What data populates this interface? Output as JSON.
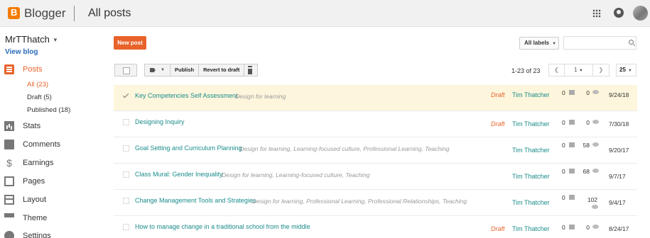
{
  "header": {
    "app_name": "Blogger",
    "page_title": "All posts"
  },
  "sidebar": {
    "blog_name": "MrTThatch",
    "view_blog": "View blog",
    "posts_label": "Posts",
    "sub_items": [
      "All (23)",
      "Draft (5)",
      "Published (18)"
    ],
    "nav": [
      "Stats",
      "Comments",
      "Earnings",
      "Pages",
      "Layout",
      "Theme",
      "Settings"
    ]
  },
  "main": {
    "new_post": "New post",
    "all_labels": "All labels",
    "search_placeholder": "",
    "toolbar": {
      "publish": "Publish",
      "revert": "Revert to draft"
    },
    "count": "1-23 of 23",
    "pager": {
      "page": "1",
      "per_page": "25"
    }
  },
  "posts": [
    {
      "title": "Key Competencies Self Assessment",
      "labels": "Design for learning",
      "status": "Draft",
      "author": "Tim Thatcher",
      "comments": "0",
      "views": "0",
      "date": "9/24/18"
    },
    {
      "title": "Designing Inquiry",
      "labels": "",
      "status": "Draft",
      "author": "Tim Thatcher",
      "comments": "0",
      "views": "0",
      "date": "7/30/18"
    },
    {
      "title": "Goal Setting and Curriculum Planning",
      "labels": "Design for learning, Learning-focused culture, Professional Learning, Teaching",
      "status": "",
      "author": "Tim Thatcher",
      "comments": "0",
      "views": "58",
      "date": "9/20/17"
    },
    {
      "title": "Class Mural: Gender Inequality",
      "labels": "Design for learning, Learning-focused culture, Teaching",
      "status": "",
      "author": "Tim Thatcher",
      "comments": "0",
      "views": "68",
      "date": "9/7/17"
    },
    {
      "title": "Change Management Tools and Strategies",
      "labels": "Design for learning, Professional Learning, Professional Relationships, Teaching",
      "status": "",
      "author": "Tim Thatcher",
      "comments": "0",
      "views": "102",
      "date": "9/4/17"
    },
    {
      "title": "How to manage change in a traditional school from the middle",
      "labels": "",
      "status": "Draft",
      "author": "Tim Thatcher",
      "comments": "0",
      "views": "0",
      "date": "8/24/17"
    }
  ]
}
